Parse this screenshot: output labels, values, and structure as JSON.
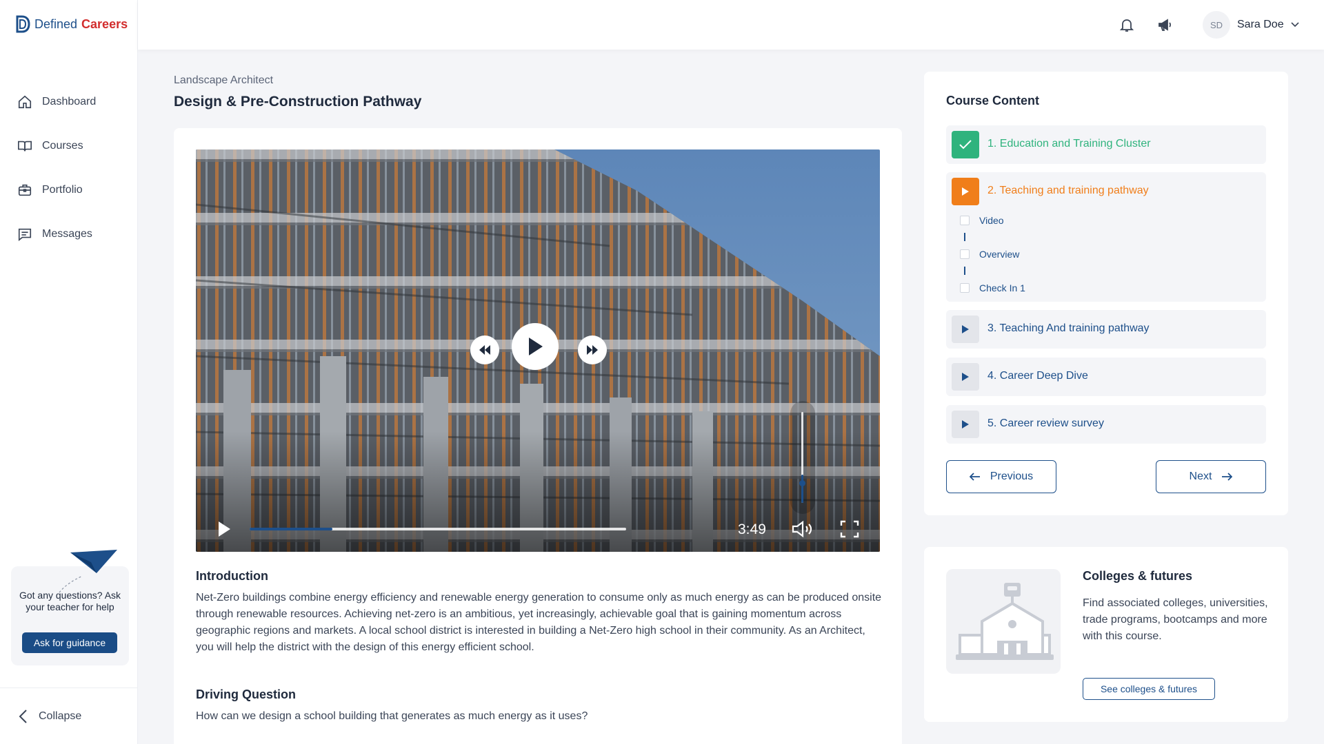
{
  "app": {
    "logo_word1": "Defined",
    "logo_word2": "Careers",
    "brand_color": "#1d4f8a",
    "accent_red": "#d22d2d"
  },
  "sidebar": {
    "items": [
      {
        "label": "Dashboard",
        "icon": "home-icon"
      },
      {
        "label": "Courses",
        "icon": "book-icon"
      },
      {
        "label": "Portfolio",
        "icon": "briefcase-icon"
      },
      {
        "label": "Messages",
        "icon": "message-icon"
      }
    ],
    "help": {
      "text": "Got any questions? Ask your teacher for help",
      "button": "Ask for guidance"
    },
    "collapse_label": "Collapse"
  },
  "header": {
    "user_initials": "SD",
    "user_name": "Sara Doe"
  },
  "main": {
    "breadcrumb": "Landscape Architect",
    "title": "Design & Pre-Construction Pathway",
    "video": {
      "time": "3:49",
      "progress": 0.22,
      "volume": 0.78
    },
    "intro_heading": "Introduction",
    "intro_text": "Net-Zero buildings combine energy efficiency and renewable energy generation to consume only as much energy as can be produced onsite through renewable resources. Achieving net-zero is an ambitious, yet increasingly, achievable goal that is gaining momentum across geographic regions and markets. A local school district is interested in building a Net-Zero high school in their community. As an Architect, you will help the district with the design of this energy efficient school.",
    "driving_heading": "Driving Question",
    "driving_text": "How can we design a school building that generates as much energy as it uses?"
  },
  "course": {
    "title": "Course Content",
    "modules": [
      {
        "label": "1. Education and Training Cluster",
        "state": "complete",
        "color": "#2fb37d"
      },
      {
        "label": "2. Teaching and training pathway",
        "state": "active",
        "color": "#f07e1a",
        "subitems": [
          "Video",
          "Overview",
          "Check In 1"
        ]
      },
      {
        "label": "3. Teaching And training pathway",
        "state": "locked",
        "color": "#1d4f8a"
      },
      {
        "label": "4. Career Deep Dive",
        "state": "locked",
        "color": "#1d4f8a"
      },
      {
        "label": "5. Career review survey",
        "state": "locked",
        "color": "#1d4f8a"
      }
    ],
    "previous_label": "Previous",
    "next_label": "Next"
  },
  "colleges": {
    "title": "Colleges & futures",
    "text": "Find associated colleges, universities, trade programs, bootcamps and more with this course.",
    "button": "See colleges & futures"
  }
}
